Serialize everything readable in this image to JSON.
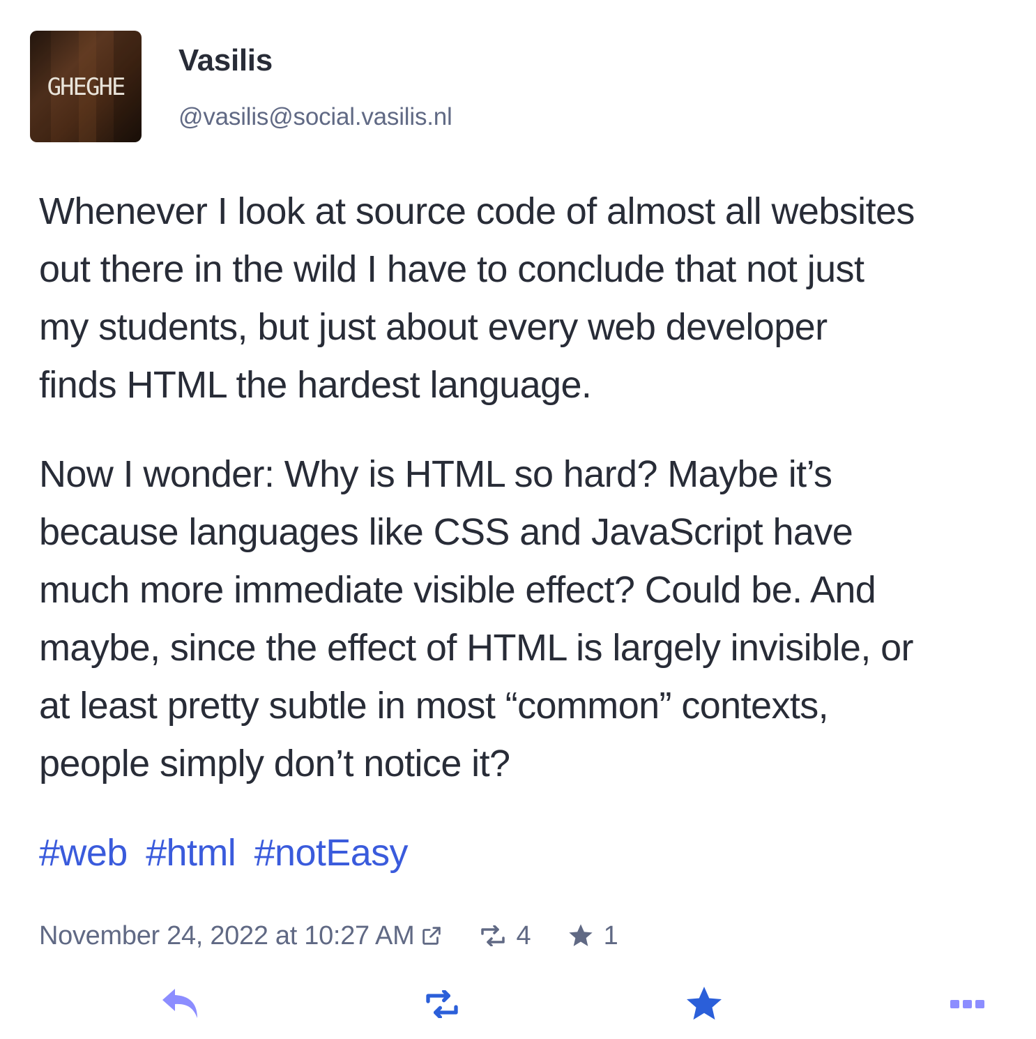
{
  "author": {
    "display_name": "Vasilis",
    "handle": "@vasilis@social.vasilis.nl",
    "avatar_text": "GHEGHE"
  },
  "content": {
    "paragraphs": [
      "Whenever I look at source code of almost all websites\nout there in the wild I have to conclude that not just\nmy students, but just about every web developer\nfinds HTML the hardest language.",
      "Now I wonder: Why is HTML so hard? Maybe it’s\nbecause languages like CSS and JavaScript have\nmuch more immediate visible effect? Could be. And\nmaybe, since the effect of HTML is largely invisible, or\nat least pretty subtle in most “common” contexts,\npeople simply don’t notice it?"
    ],
    "hashtags": [
      "#web",
      "#html",
      "#notEasy"
    ]
  },
  "meta": {
    "timestamp": "November 24, 2022 at 10:27 AM",
    "boost_count": "4",
    "favourite_count": "1"
  },
  "actions": {
    "reply_icon": "reply-icon",
    "boost_icon": "boost-icon",
    "favourite_icon": "star-icon",
    "more_icon": "more-icon"
  },
  "colors": {
    "text": "#282c37",
    "muted": "#606984",
    "link": "#3a5bdc",
    "reply": "#8c8dff",
    "boost": "#2b5fd9",
    "favourite": "#2b5fd9",
    "more": "#8c8dff"
  }
}
